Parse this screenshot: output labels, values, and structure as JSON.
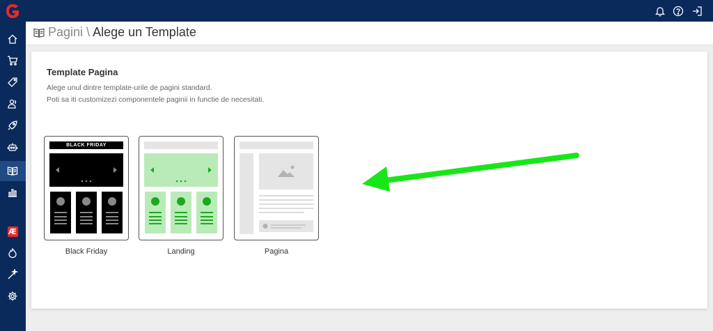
{
  "app": {
    "logo_letter": "G",
    "brand_color": "#0a2a5c",
    "accent_color": "#e32b2b"
  },
  "sidebar": {
    "items": [
      {
        "name": "home-icon"
      },
      {
        "name": "cart-icon"
      },
      {
        "name": "tag-icon"
      },
      {
        "name": "users-icon"
      },
      {
        "name": "rocket-icon"
      },
      {
        "name": "robot-icon"
      },
      {
        "name": "book-icon",
        "active": true
      },
      {
        "name": "bar-chart-icon"
      },
      {
        "name": "ae-icon",
        "label": "Æ"
      },
      {
        "name": "fire-icon"
      },
      {
        "name": "magic-wand-icon"
      },
      {
        "name": "gear-icon"
      }
    ]
  },
  "topbar": {
    "icons": [
      "bell-icon",
      "help-icon",
      "logout-icon"
    ]
  },
  "header": {
    "section": "Pagini",
    "separator": " \\ ",
    "title": "Alege un Template"
  },
  "card": {
    "title": "Template Pagina",
    "desc_line1": "Alege unul dintre template-urile de pagini standard.",
    "desc_line2": "Poti sa iti customizezi componentele paginii in functie de necesitati."
  },
  "templates": [
    {
      "label": "Black Friday",
      "banner_text": "BLACK FRIDAY",
      "color": "#000000"
    },
    {
      "label": "Landing",
      "color": "#1fa81f"
    },
    {
      "label": "Pagina",
      "color": "#e5e5e5"
    }
  ],
  "annotation": {
    "arrow_color": "#19e619"
  }
}
